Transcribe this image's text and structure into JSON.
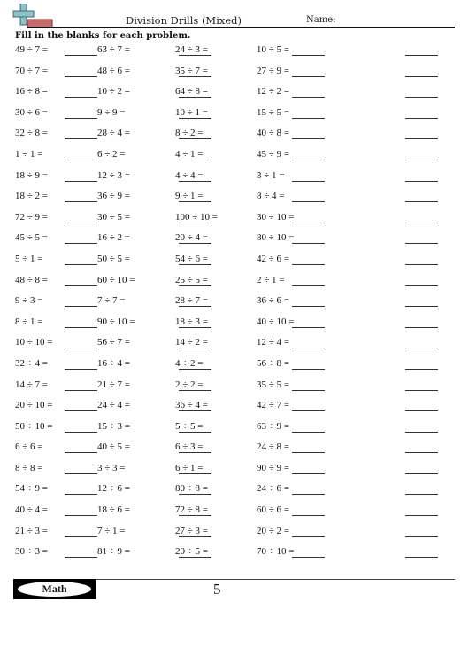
{
  "header": {
    "title": "Division Drills (Mixed)",
    "name_label": "Name:",
    "instructions": "Fill in the blanks for each problem.",
    "logo_icon": "plus-with-bar-icon"
  },
  "problems": [
    [
      "49 ÷ 7 =",
      "63 ÷ 7 =",
      "24 ÷ 3 =",
      "10 ÷ 5 ="
    ],
    [
      "70 ÷ 7 =",
      "48 ÷ 6 =",
      "35 ÷ 7 =",
      "27 ÷ 9 ="
    ],
    [
      "16 ÷ 8 =",
      "10 ÷ 2 =",
      "64 ÷ 8 =",
      "12 ÷ 2 ="
    ],
    [
      "30 ÷ 6 =",
      "9 ÷ 9 =",
      "10 ÷ 1 =",
      "15 ÷ 5 ="
    ],
    [
      "32 ÷ 8 =",
      "28 ÷ 4 =",
      "8 ÷ 2 =",
      "40 ÷ 8 ="
    ],
    [
      "1 ÷ 1 =",
      "6 ÷ 2 =",
      "4 ÷ 1 =",
      "45 ÷ 9 ="
    ],
    [
      "18 ÷ 9 =",
      "12 ÷ 3 =",
      "4 ÷ 4 =",
      "3 ÷ 1 ="
    ],
    [
      "18 ÷ 2 =",
      "36 ÷ 9 =",
      "9 ÷ 1 =",
      "8 ÷ 4 ="
    ],
    [
      "72 ÷ 9 =",
      "30 ÷ 5 =",
      "100 ÷ 10 =",
      "30 ÷ 10 ="
    ],
    [
      "45 ÷ 5 =",
      "16 ÷ 2 =",
      "20 ÷ 4 =",
      "80 ÷ 10 ="
    ],
    [
      "5 ÷ 1 =",
      "50 ÷ 5 =",
      "54 ÷ 6 =",
      "42 ÷ 6 ="
    ],
    [
      "48 ÷ 8 =",
      "60 ÷ 10 =",
      "25 ÷ 5 =",
      "2 ÷ 1 ="
    ],
    [
      "9 ÷ 3 =",
      "7 ÷ 7 =",
      "28 ÷ 7 =",
      "36 ÷ 6 ="
    ],
    [
      "8 ÷ 1 =",
      "90 ÷ 10 =",
      "18 ÷ 3 =",
      "40 ÷ 10 ="
    ],
    [
      "10 ÷ 10 =",
      "56 ÷ 7 =",
      "14 ÷ 2 =",
      "12 ÷ 4 ="
    ],
    [
      "32 ÷ 4 =",
      "16 ÷ 4 =",
      "4 ÷ 2 =",
      "56 ÷ 8 ="
    ],
    [
      "14 ÷ 7 =",
      "21 ÷ 7 =",
      "2 ÷ 2 =",
      "35 ÷ 5 ="
    ],
    [
      "20 ÷ 10 =",
      "24 ÷ 4 =",
      "36 ÷ 4 =",
      "42 ÷ 7 ="
    ],
    [
      "50 ÷ 10 =",
      "15 ÷ 3 =",
      "5 ÷ 5 =",
      "63 ÷ 9 ="
    ],
    [
      "6 ÷ 6 =",
      "40 ÷ 5 =",
      "6 ÷ 3 =",
      "24 ÷ 8 ="
    ],
    [
      "8 ÷ 8 =",
      "3 ÷ 3 =",
      "6 ÷ 1 =",
      "90 ÷ 9 ="
    ],
    [
      "54 ÷ 9 =",
      "12 ÷ 6 =",
      "80 ÷ 8 =",
      "24 ÷ 6 ="
    ],
    [
      "40 ÷ 4 =",
      "18 ÷ 6 =",
      "72 ÷ 8 =",
      "60 ÷ 6 ="
    ],
    [
      "21 ÷ 3 =",
      "7 ÷ 1 =",
      "27 ÷ 3 =",
      "20 ÷ 2 ="
    ],
    [
      "30 ÷ 3 =",
      "81 ÷ 9 =",
      "20 ÷ 5 =",
      "70 ÷ 10 ="
    ]
  ],
  "footer": {
    "badge_label": "Math",
    "page_number": "5"
  }
}
